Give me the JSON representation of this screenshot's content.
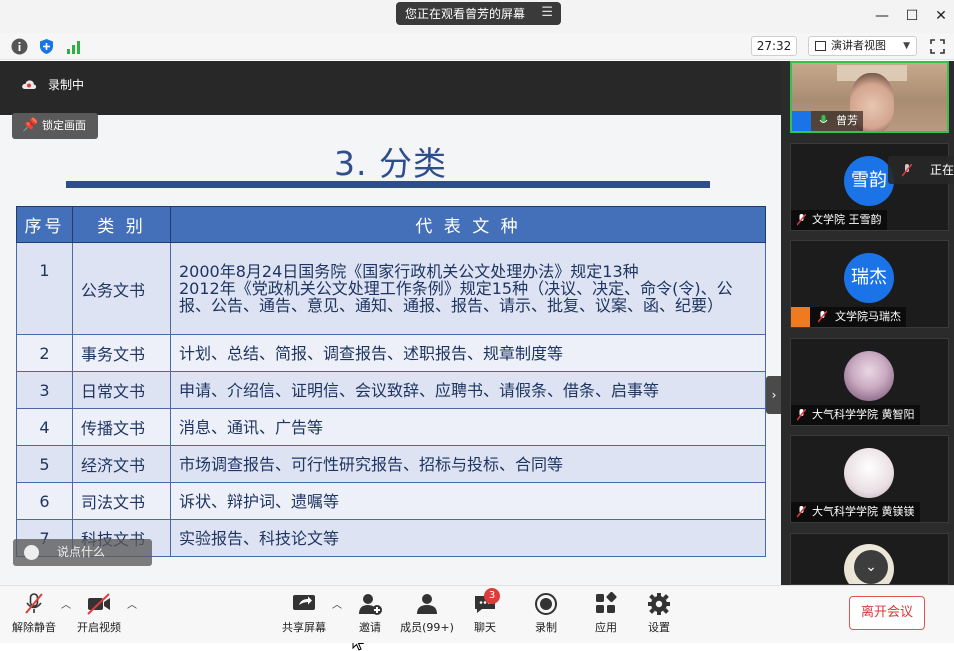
{
  "titlebar": {
    "viewing_text": "您正在观看曾芳的屏幕",
    "window_controls": [
      "minimize-icon",
      "maximize-icon",
      "close-icon"
    ]
  },
  "toolbar": {
    "timer": "27:32",
    "view_mode": "演讲者视图",
    "icons": [
      "info-icon",
      "shield-icon",
      "signal-icon",
      "fullscreen-icon"
    ]
  },
  "recording": {
    "label": "录制中",
    "lock_label": "锁定画面"
  },
  "slide": {
    "title": "3. 分类",
    "table": {
      "headers": [
        "序号",
        "类 别",
        "代 表 文 种"
      ],
      "rows": [
        {
          "no": "1",
          "category": "公务文书",
          "rep": [
            "2000年8月24日国务院《国家行政机关公文处理办法》规定13种",
            "2012年《党政机关公文处理工作条例》规定15种（决议、决定、命令(令)、公报、公告、通告、意见、通知、通报、报告、请示、批复、议案、函、纪要）"
          ]
        },
        {
          "no": "2",
          "category": "事务文书",
          "rep": [
            "计划、总结、简报、调查报告、述职报告、规章制度等"
          ]
        },
        {
          "no": "3",
          "category": "日常文书",
          "rep": [
            "申请、介绍信、证明信、会议致辞、应聘书、请假条、借条、启事等"
          ]
        },
        {
          "no": "4",
          "category": "传播文书",
          "rep": [
            "消息、通讯、广告等"
          ]
        },
        {
          "no": "5",
          "category": "经济文书",
          "rep": [
            "市场调查报告、可行性研究报告、招标与投标、合同等"
          ]
        },
        {
          "no": "6",
          "category": "司法文书",
          "rep": [
            "诉状、辩护词、遗嘱等"
          ]
        },
        {
          "no": "7",
          "category": "科技文书",
          "rep": [
            "实验报告、科技论文等"
          ]
        }
      ]
    },
    "comment_placeholder": "说点什么"
  },
  "gallery": {
    "speaking_label": "正在",
    "participants": [
      {
        "name": "曾芳",
        "avatar": "",
        "video": true
      },
      {
        "name": "文学院 王雪韵",
        "avatar": "雪韵",
        "video": false
      },
      {
        "name": "文学院马瑞杰",
        "avatar": "瑞杰",
        "video": false
      },
      {
        "name": "大气科学学院 黄智阳",
        "avatar": "",
        "video": false
      },
      {
        "name": "大气科学学院 黄镁镁",
        "avatar": "",
        "video": false
      }
    ]
  },
  "controls": {
    "unmute": "解除静音",
    "start_video": "开启视频",
    "share_screen": "共享屏幕",
    "invite": "邀请",
    "members": "成员(99+)",
    "chat": "聊天",
    "chat_badge": "3",
    "record": "录制",
    "apps": "应用",
    "settings": "设置",
    "leave": "离开会议"
  },
  "colors": {
    "slide_title": "#2e4d8f",
    "table_header": "#4470b9",
    "gallery_bg": "#2b2b2b",
    "active_speaker_border": "#37c24f",
    "leave_red": "#d93838"
  }
}
